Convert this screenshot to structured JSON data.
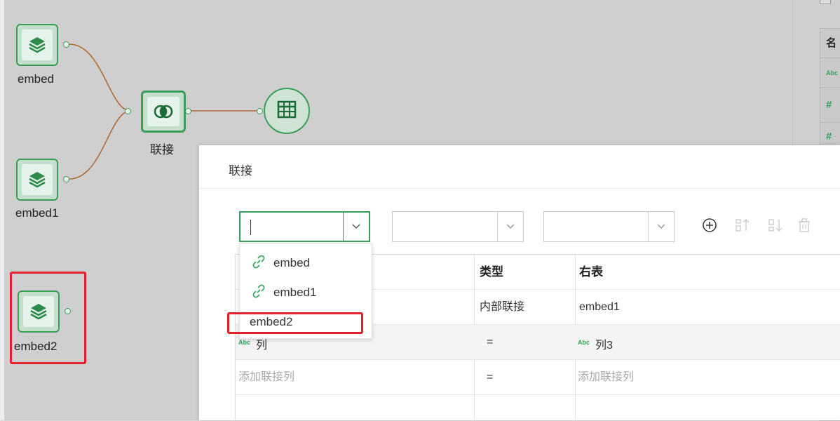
{
  "canvas": {
    "nodes": [
      {
        "label": "embed",
        "icon": "layers-icon"
      },
      {
        "label": "embed1",
        "icon": "layers-icon"
      },
      {
        "label": "embed2",
        "icon": "layers-icon"
      }
    ],
    "join_node": {
      "label": "联接",
      "icon": "join-icon"
    },
    "table_node": {
      "icon": "table-icon"
    },
    "colors": {
      "green": "#3a9d5a",
      "edge": "#b06a35",
      "highlight": "#e5202e"
    }
  },
  "right_panel": {
    "header": "名",
    "rows": [
      "Abc",
      "#",
      "#"
    ]
  },
  "dialog": {
    "title": "联接",
    "select1_value": "",
    "select2_value": "",
    "select3_value": "",
    "toolbar": [
      "add-circle-icon",
      "sort-asc-icon",
      "sort-desc-icon",
      "delete-icon"
    ],
    "dropdown": [
      {
        "label": "embed",
        "icon": "link-icon"
      },
      {
        "label": "embed1",
        "icon": "link-icon"
      },
      {
        "label": "embed2"
      }
    ],
    "grid": {
      "headers": {
        "type": "类型",
        "right": "右表"
      },
      "rows": [
        {
          "left": "",
          "type": "内部联接",
          "right": "embed1",
          "alt": false
        },
        {
          "left_abc": "Abc",
          "left": "列",
          "type": "=",
          "right_abc": "Abc",
          "right": "列3",
          "alt": true
        },
        {
          "left": "添加联接列",
          "type": "=",
          "right": "添加联接列",
          "placeholder": true,
          "alt": false
        }
      ]
    }
  }
}
